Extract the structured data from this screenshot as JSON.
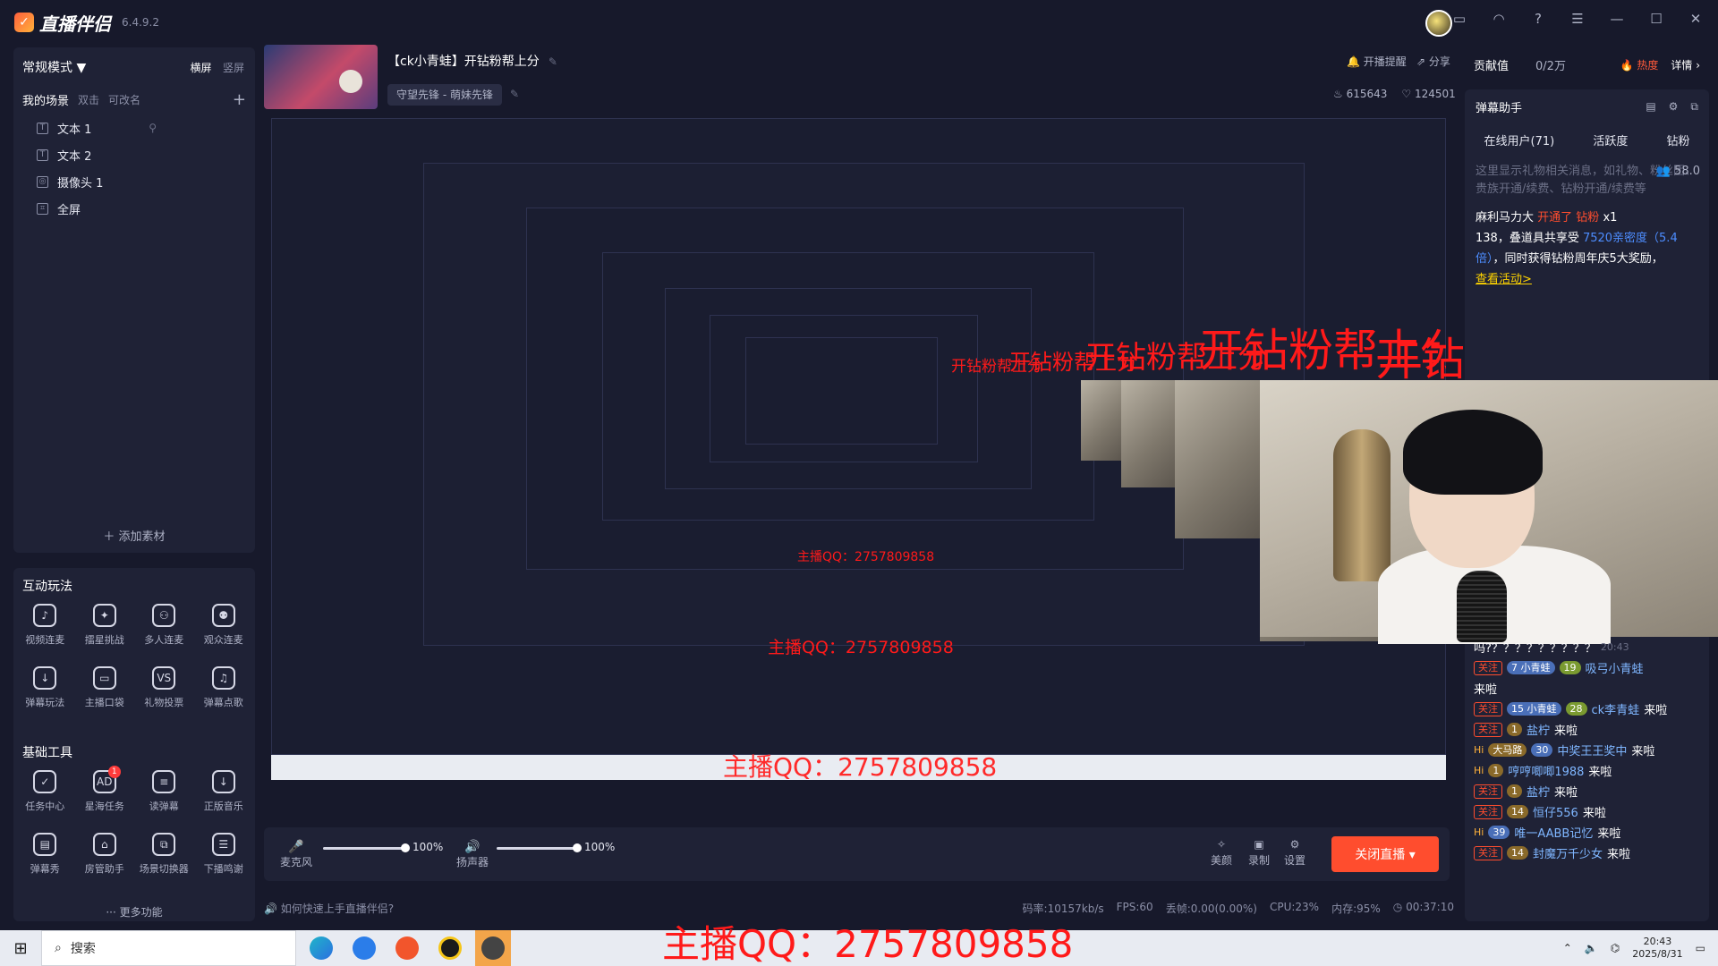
{
  "app": {
    "name": "直播伴侣",
    "version": "6.4.9.2"
  },
  "sidebar": {
    "mode": "常规模式 ▼",
    "orient": [
      "横屏",
      "竖屏"
    ],
    "scene_label": "我的场景",
    "scene_hint1": "双击",
    "scene_hint2": "可改名",
    "sources": [
      {
        "icon": "T",
        "label": "文本 1"
      },
      {
        "icon": "T",
        "label": "文本 2"
      },
      {
        "icon": "◎",
        "label": "摄像头 1"
      },
      {
        "icon": "⌗",
        "label": "全屏"
      }
    ],
    "add_source": "＋ 添加素材"
  },
  "interact": {
    "title": "互动玩法",
    "tools": [
      {
        "icon": "mic",
        "label": "视频连麦"
      },
      {
        "icon": "shield",
        "label": "擂星挑战"
      },
      {
        "icon": "multi",
        "label": "多人连麦"
      },
      {
        "icon": "user-plus",
        "label": "观众连麦"
      },
      {
        "icon": "download",
        "label": "弹幕玩法"
      },
      {
        "icon": "bag",
        "label": "主播口袋"
      },
      {
        "icon": "vs",
        "label": "礼物投票"
      },
      {
        "icon": "music",
        "label": "弹幕点歌"
      }
    ]
  },
  "basic": {
    "title": "基础工具",
    "tools": [
      {
        "icon": "clipboard",
        "label": "任务中心",
        "badge": ""
      },
      {
        "icon": "AD",
        "label": "星海任务",
        "badge": "1"
      },
      {
        "icon": "read",
        "label": "读弹幕",
        "badge": ""
      },
      {
        "icon": "download",
        "label": "正版音乐",
        "badge": ""
      },
      {
        "icon": "screen",
        "label": "弹幕秀",
        "badge": ""
      },
      {
        "icon": "house",
        "label": "房管助手",
        "badge": ""
      },
      {
        "icon": "switch",
        "label": "场景切换器",
        "badge": ""
      },
      {
        "icon": "list",
        "label": "下播鸣谢",
        "badge": ""
      }
    ],
    "more": "··· 更多功能"
  },
  "room": {
    "title": "【ck小青蛙】开钻粉帮上分",
    "category": "守望先锋 - 萌妹先锋",
    "remind": "开播提醒",
    "share": "分享",
    "likes": "615643",
    "hearts": "124501"
  },
  "preview": {
    "overlay_text": "开钻粉帮上分",
    "qq_text": "主播QQ：2757809858"
  },
  "controls": {
    "mic_label": "麦克风",
    "mic_volume": "100%",
    "speaker_label": "扬声器",
    "speaker_volume": "100%",
    "beauty": "美颜",
    "record": "录制",
    "settings": "设置",
    "live_button": "关闭直播 ▾"
  },
  "status": {
    "tip": "如何快速上手直播伴侣?",
    "bitrate": "码率:10157kb/s",
    "fps": "FPS:60",
    "drop": "丢帧:0.00(0.00%)",
    "cpu": "CPU:23%",
    "mem": "内存:95%",
    "time": "00:37:10"
  },
  "right": {
    "contrib_label": "贡献值",
    "contrib_value": "0/2万",
    "hot": "热度",
    "detail": "详情 ›",
    "danmu_title": "弹幕助手",
    "tabs": [
      "在线用户(71)",
      "活跃度",
      "钻粉"
    ],
    "notice": "这里显示礼物相关消息，如礼物、粉丝团、贵族开通/续费、钻粉开通/续费等",
    "fan_count": "58.0",
    "gift_user": "麻利马力大",
    "gift_action": "开通了 钻粉",
    "gift_x": "x1",
    "gift_text1": "138，叠道具共享受 ",
    "gift_density": "7520亲密度（5.4倍）",
    "gift_text2": "，同时获得钻粉周年庆5大奖励，",
    "gift_link": "查看活动>",
    "chat_top": "吗?？？？？？？？？？",
    "chat_top_time": "20:43",
    "chat": [
      {
        "tag": "关注",
        "lvl": "7 小青蛙",
        "lvl2": "19",
        "user": "吸弓小青蛙",
        "msg": "来啦"
      },
      {
        "tag": "关注",
        "lvl": "15 小青蛙",
        "lvl2": "28",
        "user": "ck李青蛙",
        "msg": "来啦"
      },
      {
        "tag": "关注",
        "lvl": "1",
        "lvl2": "",
        "user": "盐柠",
        "msg": "来啦"
      },
      {
        "tag": "Hi",
        "lvl": "大马路",
        "lvl2": "30",
        "user": "中奖王王奖中",
        "msg": "来啦"
      },
      {
        "tag": "Hi",
        "lvl": "1",
        "lvl2": "",
        "user": "哼哼唧唧1988",
        "msg": "来啦"
      },
      {
        "tag": "关注",
        "lvl": "1",
        "lvl2": "",
        "user": "盐柠",
        "msg": "来啦"
      },
      {
        "tag": "关注",
        "lvl": "14",
        "lvl2": "",
        "user": "恒仔556",
        "msg": "来啦"
      },
      {
        "tag": "Hi",
        "lvl": "39",
        "lvl2": "",
        "user": "唯一AABB记忆",
        "msg": "来啦"
      },
      {
        "tag": "关注",
        "lvl": "14",
        "lvl2": "",
        "user": "封魔万千少女",
        "msg": "来啦"
      }
    ]
  },
  "taskbar": {
    "search": "搜索",
    "qq_text": "主播QQ：2757809858",
    "time": "20:43",
    "date": "2025/8/31"
  }
}
